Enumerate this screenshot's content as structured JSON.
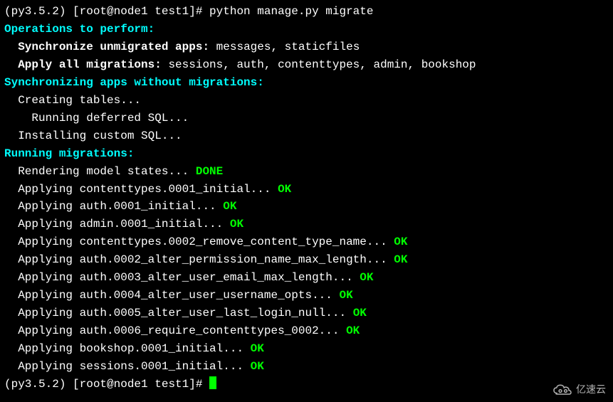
{
  "prompt": {
    "venv": "(py3.5.2) ",
    "userhost": "[root@node1 test1]# ",
    "command": "python manage.py migrate"
  },
  "sections": {
    "operations_header": "Operations to perform:",
    "sync_apps_label": "  Synchronize unmigrated apps: ",
    "sync_apps_value": "messages, staticfiles",
    "apply_migrations_label": "  Apply all migrations: ",
    "apply_migrations_value": "sessions, auth, contenttypes, admin, bookshop",
    "sync_without_header": "Synchronizing apps without migrations:",
    "creating_tables": "  Creating tables...",
    "running_deferred": "    Running deferred SQL...",
    "installing_custom": "  Installing custom SQL...",
    "running_migrations_header": "Running migrations:",
    "rendering_states": "  Rendering model states... ",
    "done": "DONE"
  },
  "migrations": [
    {
      "text": "  Applying contenttypes.0001_initial... ",
      "status": "OK"
    },
    {
      "text": "  Applying auth.0001_initial... ",
      "status": "OK"
    },
    {
      "text": "  Applying admin.0001_initial... ",
      "status": "OK"
    },
    {
      "text": "  Applying contenttypes.0002_remove_content_type_name... ",
      "status": "OK"
    },
    {
      "text": "  Applying auth.0002_alter_permission_name_max_length... ",
      "status": "OK"
    },
    {
      "text": "  Applying auth.0003_alter_user_email_max_length... ",
      "status": "OK"
    },
    {
      "text": "  Applying auth.0004_alter_user_username_opts... ",
      "status": "OK"
    },
    {
      "text": "  Applying auth.0005_alter_user_last_login_null... ",
      "status": "OK"
    },
    {
      "text": "  Applying auth.0006_require_contenttypes_0002... ",
      "status": "OK"
    },
    {
      "text": "  Applying bookshop.0001_initial... ",
      "status": "OK"
    },
    {
      "text": "  Applying sessions.0001_initial... ",
      "status": "OK"
    }
  ],
  "prompt_end": {
    "venv": "(py3.5.2) ",
    "userhost": "[root@node1 test1]# "
  },
  "watermark": "亿速云"
}
